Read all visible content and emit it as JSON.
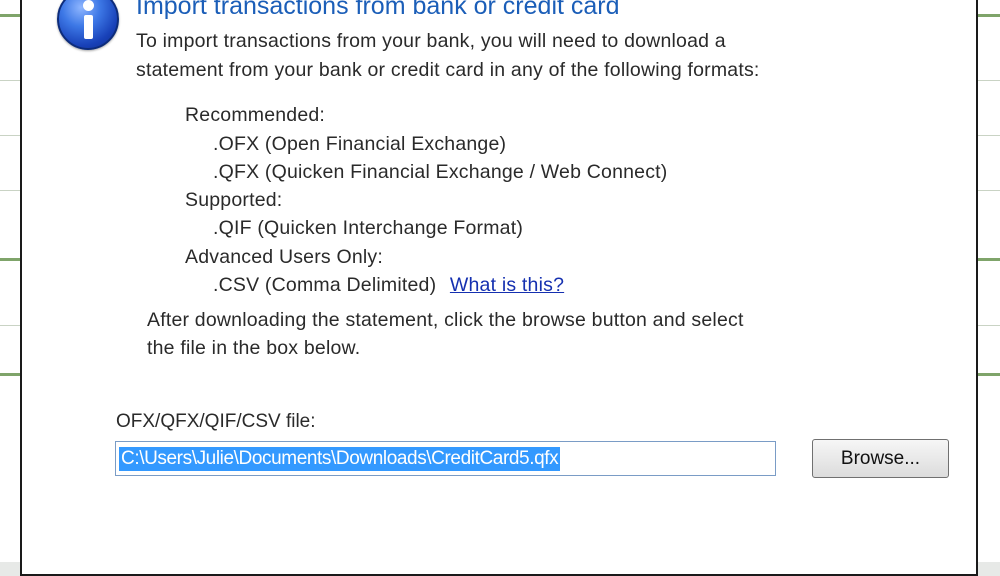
{
  "dialog": {
    "title": "Import transactions from bank or credit card",
    "intro_line1": "To import transactions from your bank, you will need to download a",
    "intro_line2": "statement from your bank or credit card in any of the following formats:",
    "formats": {
      "recommended_heading": "Recommended:",
      "ofx": ".OFX (Open Financial Exchange)",
      "qfx": ".QFX (Quicken Financial Exchange / Web Connect)",
      "supported_heading": "Supported:",
      "qif": ".QIF  (Quicken Interchange Format)",
      "advanced_heading": "Advanced Users Only:",
      "csv": ".CSV (Comma Delimited)",
      "csv_link": "What is this?"
    },
    "after_line1": "After downloading the statement, click the browse button and select",
    "after_line2": "the file in the box below.",
    "file_label": "OFX/QFX/QIF/CSV file:",
    "file_value": "C:\\Users\\Julie\\Documents\\Downloads\\CreditCard5.qfx",
    "browse_label": "Browse..."
  },
  "icons": {
    "info": "info-icon"
  },
  "colors": {
    "title": "#1b5eb8",
    "link": "#1530b0",
    "selection": "#3399ff"
  }
}
